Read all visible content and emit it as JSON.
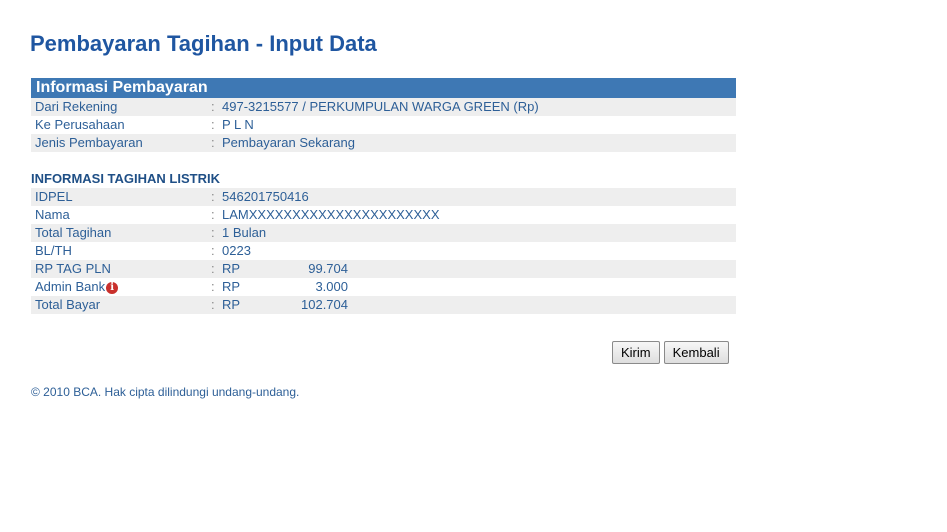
{
  "page_title": "Pembayaran Tagihan - Input Data",
  "payment_info": {
    "header": "Informasi Pembayaran",
    "rows": [
      {
        "label": "Dari Rekening",
        "value": "497-3215577 / PERKUMPULAN WARGA GREEN (Rp)"
      },
      {
        "label": "Ke Perusahaan",
        "value": "P L N"
      },
      {
        "label": "Jenis Pembayaran",
        "value": "Pembayaran Sekarang"
      }
    ]
  },
  "bill_info": {
    "title": "INFORMASI TAGIHAN LISTRIK",
    "rows": [
      {
        "label": "IDPEL",
        "value": "546201750416"
      },
      {
        "label": "Nama",
        "value": "LAMXXXXXXXXXXXXXXXXXXXXXX"
      },
      {
        "label": "Total Tagihan",
        "value": "1 Bulan"
      },
      {
        "label": "BL/TH",
        "value": "0223"
      }
    ],
    "amounts": [
      {
        "label": "RP TAG PLN",
        "currency": "RP",
        "amount": "99.704"
      },
      {
        "label": "Admin Bank",
        "currency": "RP",
        "amount": "3.000"
      },
      {
        "label": "Total Bayar",
        "currency": "RP",
        "amount": "102.704"
      }
    ]
  },
  "colon": ":",
  "icons": {
    "admin_info": "info-icon"
  },
  "buttons": {
    "submit_label": "Kirim",
    "back_label": "Kembali"
  },
  "footer": "©  2010 BCA. Hak cipta dilindungi undang-undang."
}
